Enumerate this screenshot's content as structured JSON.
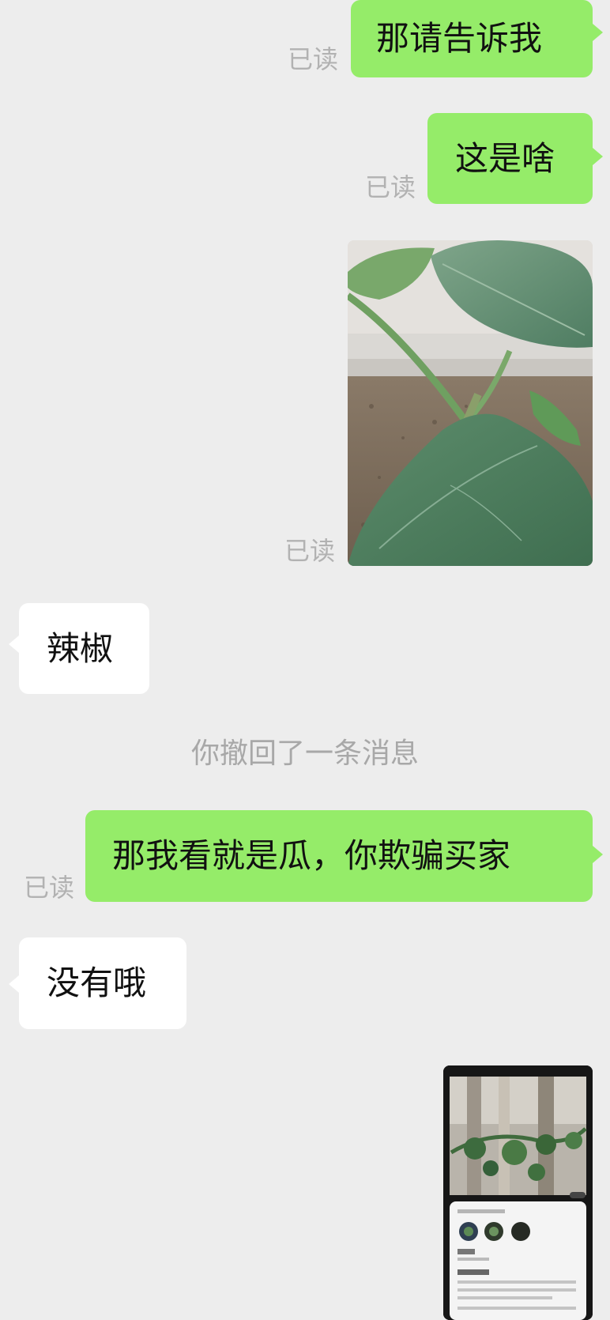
{
  "read_label": "已读",
  "messages": [
    {
      "from": "me",
      "text": "那请告诉我"
    },
    {
      "from": "me",
      "text": "这是啥"
    },
    {
      "from": "me",
      "type": "image",
      "alt": "plant-photo"
    },
    {
      "from": "them",
      "text": "辣椒"
    },
    {
      "system": "你撤回了一条消息"
    },
    {
      "from": "me",
      "text": "那我看就是瓜，你欺骗买家"
    },
    {
      "from": "them",
      "text": "没有哦"
    },
    {
      "from": "me",
      "type": "image",
      "alt": "plant-identification-screenshot"
    }
  ],
  "colors": {
    "background": "#ededed",
    "outgoing_bubble": "#95ec69",
    "incoming_bubble": "#ffffff",
    "read_text": "#b2b2b2",
    "system_text": "#a8a8a8"
  }
}
